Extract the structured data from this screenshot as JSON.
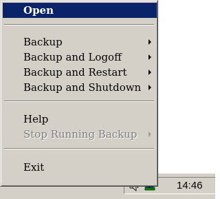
{
  "menu": {
    "items": [
      {
        "label": "Open"
      },
      {
        "label": "Backup"
      },
      {
        "label": "Backup and Logoff"
      },
      {
        "label": "Backup and Restart"
      },
      {
        "label": "Backup and Shutdown"
      },
      {
        "label": "Help"
      },
      {
        "label": "Stop Running Backup"
      },
      {
        "label": "Exit"
      }
    ]
  },
  "taskbar": {
    "clock": "14:46",
    "tray_icons": [
      "speaker-icon",
      "backup-tray-icon"
    ]
  },
  "colors": {
    "menu_bg": "#d4d0c8",
    "highlight": "#0a246a",
    "disabled_text": "#808080"
  }
}
